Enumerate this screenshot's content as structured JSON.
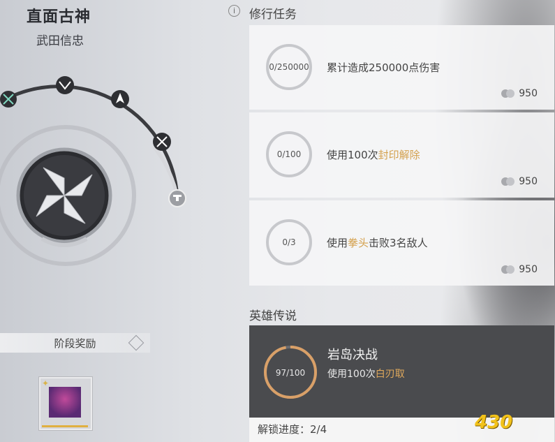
{
  "header": {
    "title": "直面古神",
    "subtitle": "武田信忠"
  },
  "left": {
    "stage_reward_label": "阶段奖励",
    "reward_item": "armor-helmet-icon"
  },
  "tasks_section": {
    "info_icon": "i",
    "title": "修行任务",
    "tasks": [
      {
        "progress": "0/250000",
        "desc_pre": "累计造成250000点伤害",
        "highlight": "",
        "desc_post": "",
        "reward": "950"
      },
      {
        "progress": "0/100",
        "desc_pre": "使用100次",
        "highlight": "封印解除",
        "desc_post": "",
        "reward": "950"
      },
      {
        "progress": "0/3",
        "desc_pre": "使用",
        "highlight": "拳头",
        "desc_post": "击败3名敌人",
        "reward": "950"
      }
    ]
  },
  "legend_section": {
    "title": "英雄传说",
    "name": "岩岛决战",
    "progress": "97/100",
    "progress_fraction": 0.97,
    "desc_pre": "使用100次",
    "highlight": "白刃取",
    "unlock_label": "解锁进度：2/4"
  },
  "watermark": "430",
  "colors": {
    "accent": "#d4a14e",
    "legend_bg": "#4a4b4e",
    "ring_progress": "#d9a068"
  }
}
